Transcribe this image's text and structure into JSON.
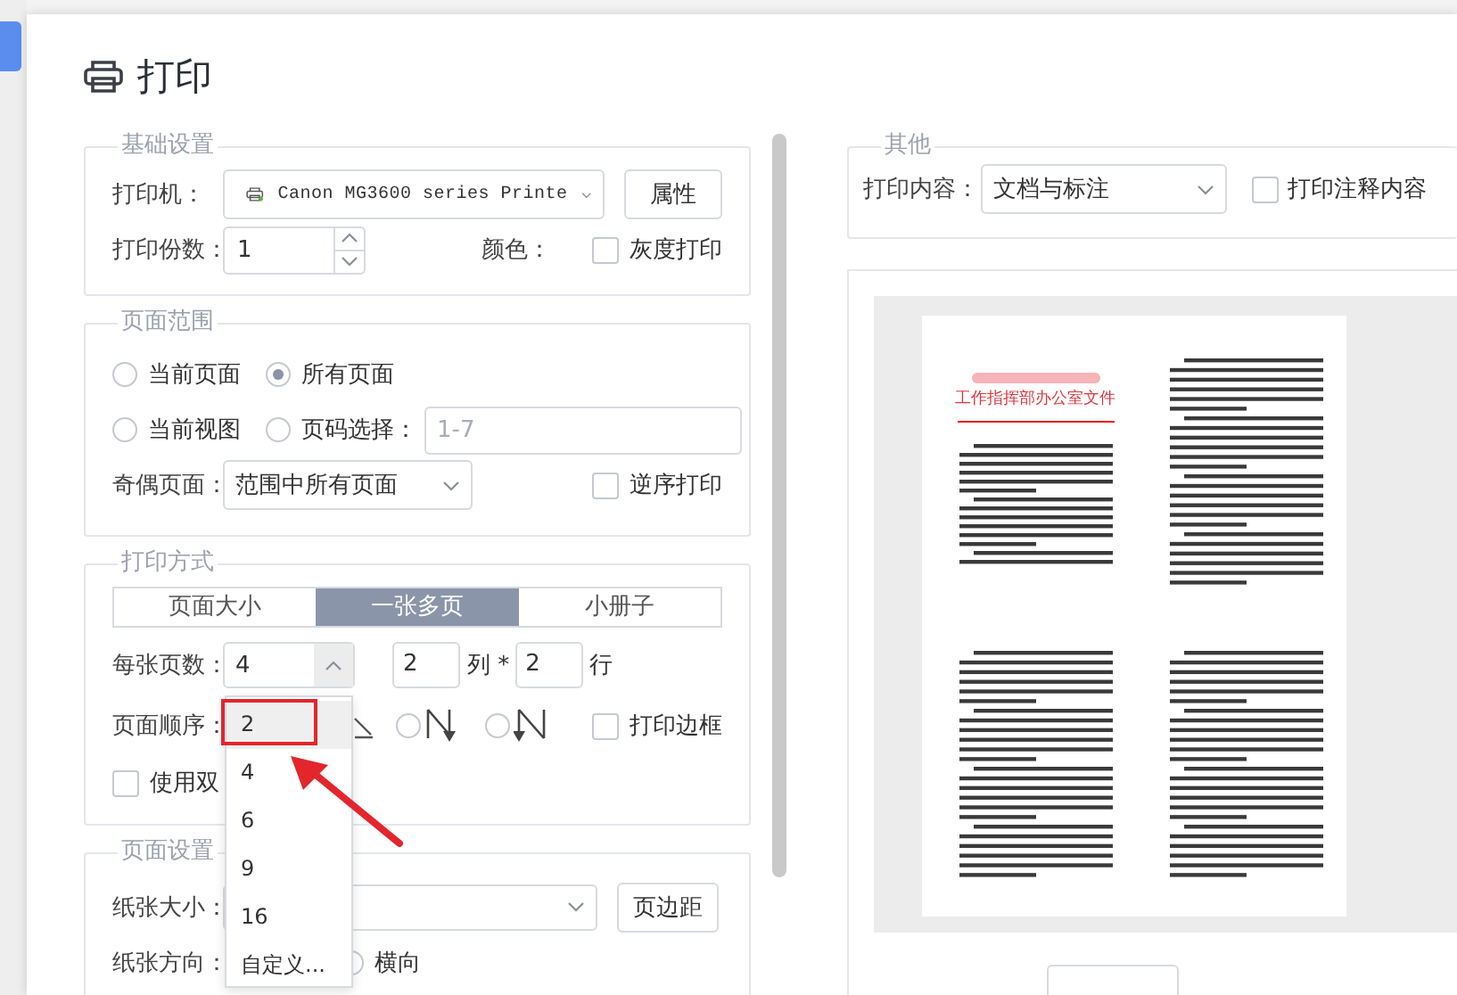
{
  "dialog": {
    "title": "打印"
  },
  "basic": {
    "legend": "基础设置",
    "printer_label": "打印机：",
    "printer": "Canon MG3600 series Printe",
    "properties_button": "属性",
    "copies_label": "打印份数：",
    "copies": "1",
    "color_label": "颜色：",
    "grayscale": {
      "label": "灰度打印",
      "checked": false
    }
  },
  "page_range": {
    "legend": "页面范围",
    "options": [
      {
        "label": "当前页面",
        "selected": false
      },
      {
        "label": "所有页面",
        "selected": true
      },
      {
        "label": "当前视图",
        "selected": false
      },
      {
        "label": "页码选择：",
        "selected": false
      }
    ],
    "pages_placeholder": "1-7",
    "odd_even_label": "奇偶页面：",
    "odd_even": "范围中所有页面",
    "reverse": {
      "label": "逆序打印",
      "checked": false
    }
  },
  "print_mode": {
    "legend": "打印方式",
    "tabs": [
      {
        "label": "页面大小",
        "selected": false
      },
      {
        "label": "一张多页",
        "selected": true
      },
      {
        "label": "小册子",
        "selected": false
      }
    ],
    "per_sheet_label": "每张页数：",
    "per_sheet": "4",
    "columns": "2",
    "columns_label": "列 *",
    "rows": "2",
    "rows_label": "行",
    "order_label": "页面顺序：",
    "order_options": [
      {
        "kind": "down-across",
        "selected": false
      },
      {
        "kind": "n-shape",
        "selected": false
      }
    ],
    "print_border": {
      "label": "打印边框",
      "checked": false
    },
    "duplex": {
      "label": "使用双",
      "checked": false
    },
    "per_sheet_menu": [
      {
        "label": "2",
        "selected": true
      },
      {
        "label": "4",
        "selected": false
      },
      {
        "label": "6",
        "selected": false
      },
      {
        "label": "9",
        "selected": false
      },
      {
        "label": "16",
        "selected": false
      },
      {
        "label": "自定义...",
        "selected": false
      }
    ]
  },
  "page_setup": {
    "legend": "页面设置",
    "paper_size_label": "纸张大小：",
    "margins_button": "页边距",
    "orientation_label": "纸张方向：",
    "orientation_options": [
      {
        "label": "横向",
        "selected": false
      }
    ]
  },
  "other": {
    "legend": "其他",
    "content_label": "打印内容：",
    "content": "文档与标注",
    "annotations": {
      "label": "打印注释内容",
      "checked": false
    }
  },
  "preview": {
    "document_title": "工作指挥部办公室文件"
  }
}
